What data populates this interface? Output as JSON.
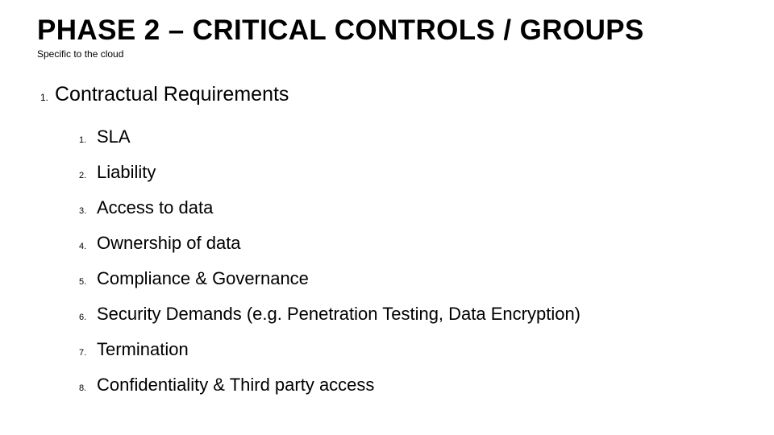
{
  "header": {
    "title": "PHASE 2 – CRITICAL CONTROLS / GROUPS",
    "subtitle": "Specific to the cloud"
  },
  "outline": {
    "level1": {
      "num": "1.",
      "text": "Contractual Requirements"
    },
    "level2": [
      {
        "num": "1.",
        "text": "SLA"
      },
      {
        "num": "2.",
        "text": "Liability"
      },
      {
        "num": "3.",
        "text": "Access to data"
      },
      {
        "num": "4.",
        "text": "Ownership of data"
      },
      {
        "num": "5.",
        "text": "Compliance & Governance"
      },
      {
        "num": "6.",
        "text": "Security Demands (e.g. Penetration Testing, Data Encryption)"
      },
      {
        "num": "7.",
        "text": "Termination"
      },
      {
        "num": "8.",
        "text": "Confidentiality & Third party access"
      }
    ]
  }
}
